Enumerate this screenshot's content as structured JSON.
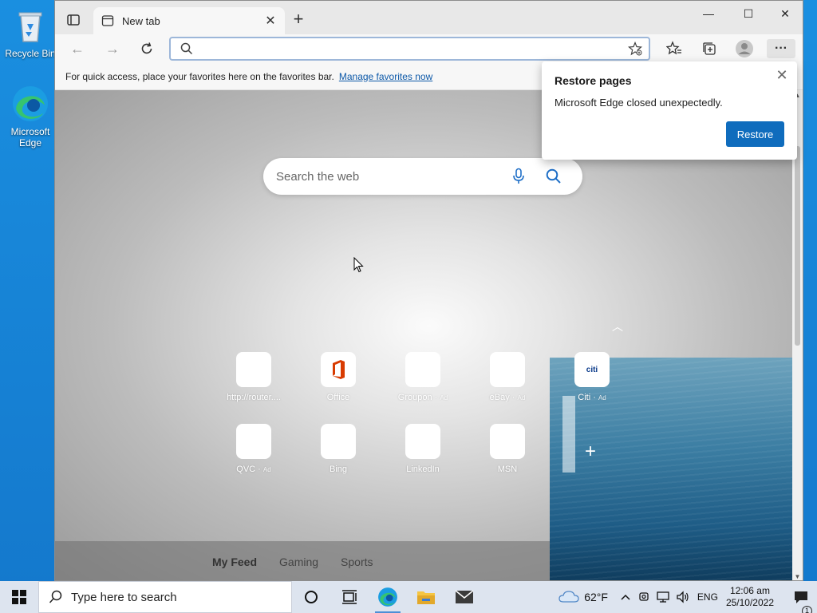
{
  "desktop": {
    "icons": [
      {
        "label": "Recycle Bin"
      },
      {
        "label": "Microsoft Edge"
      }
    ]
  },
  "browser": {
    "tab": {
      "title": "New tab"
    },
    "favorites_bar": {
      "message": "For quick access, place your favorites here on the favorites bar.",
      "link": "Manage favorites now"
    },
    "address_bar": {
      "value": "",
      "placeholder": ""
    },
    "newtab": {
      "search_placeholder": "Search the web",
      "tiles": [
        {
          "label": "http://router....",
          "ad": ""
        },
        {
          "label": "Office",
          "ad": ""
        },
        {
          "label": "Groupon",
          "ad": "Ad"
        },
        {
          "label": "eBay",
          "ad": "Ad"
        },
        {
          "label": "Citi",
          "ad": "Ad",
          "logo_text": "citi"
        },
        {
          "label": "QVC",
          "ad": "Ad"
        },
        {
          "label": "Bing",
          "ad": ""
        },
        {
          "label": "LinkedIn",
          "ad": ""
        },
        {
          "label": "MSN",
          "ad": ""
        }
      ],
      "feed_tabs": [
        "My Feed",
        "Gaming",
        "Sports"
      ]
    },
    "restore_popup": {
      "title": "Restore pages",
      "message": "Microsoft Edge closed unexpectedly.",
      "button": "Restore"
    }
  },
  "taskbar": {
    "search_placeholder": "Type here to search",
    "weather": "62°F",
    "language": "ENG",
    "time": "12:06 am",
    "date": "25/10/2022",
    "notification_count": "1"
  },
  "colors": {
    "accent": "#0f6cbd",
    "link": "#0c58a8",
    "desktop": "#1a8fe0"
  }
}
